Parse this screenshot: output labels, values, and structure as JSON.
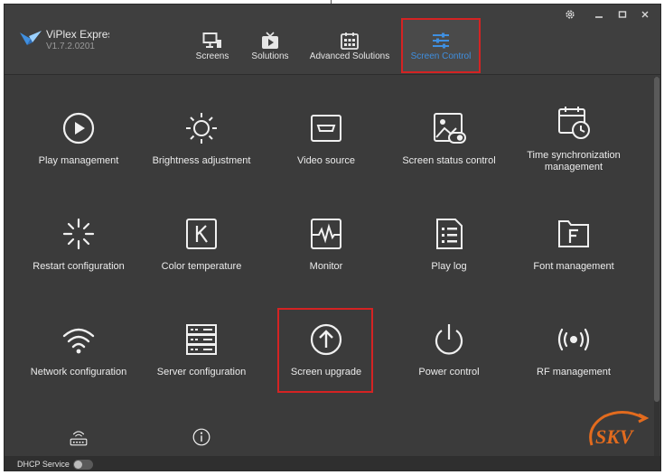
{
  "app": {
    "name": "ViPlex Express",
    "version": "V1.7.2.0201"
  },
  "tabs": [
    {
      "label": "Screens",
      "icon": "monitor-icon"
    },
    {
      "label": "Solutions",
      "icon": "play-tv-icon"
    },
    {
      "label": "Advanced Solutions",
      "icon": "calendar-grid-icon"
    },
    {
      "label": "Screen Control",
      "icon": "sliders-icon",
      "active": true
    }
  ],
  "tiles": [
    {
      "label": "Play management",
      "icon": "play-circle-icon"
    },
    {
      "label": "Brightness adjustment",
      "icon": "sun-icon"
    },
    {
      "label": "Video source",
      "icon": "video-source-icon"
    },
    {
      "label": "Screen status control",
      "icon": "screen-status-icon"
    },
    {
      "label": "Time synchronization management",
      "icon": "calendar-clock-icon"
    },
    {
      "label": "Restart configuration",
      "icon": "restart-spinner-icon"
    },
    {
      "label": "Color temperature",
      "icon": "k-letter-icon"
    },
    {
      "label": "Monitor",
      "icon": "pulse-monitor-icon"
    },
    {
      "label": "Play log",
      "icon": "log-document-icon"
    },
    {
      "label": "Font management",
      "icon": "font-folder-icon"
    },
    {
      "label": "Network configuration",
      "icon": "wifi-icon"
    },
    {
      "label": "Server configuration",
      "icon": "server-icon"
    },
    {
      "label": "Screen upgrade",
      "icon": "upload-arrow-icon"
    },
    {
      "label": "Power control",
      "icon": "power-icon"
    },
    {
      "label": "RF management",
      "icon": "rf-signal-icon"
    },
    {
      "label": "",
      "icon": "router-icon"
    },
    {
      "label": "",
      "icon": "info-icon"
    }
  ],
  "status": {
    "dhcp_label": "DHCP Service",
    "dhcp_on": false
  },
  "watermark": {
    "text": "SKV"
  },
  "colors": {
    "accent": "#3f8fe0",
    "highlight": "#d42323",
    "background": "#3b3b3b"
  }
}
